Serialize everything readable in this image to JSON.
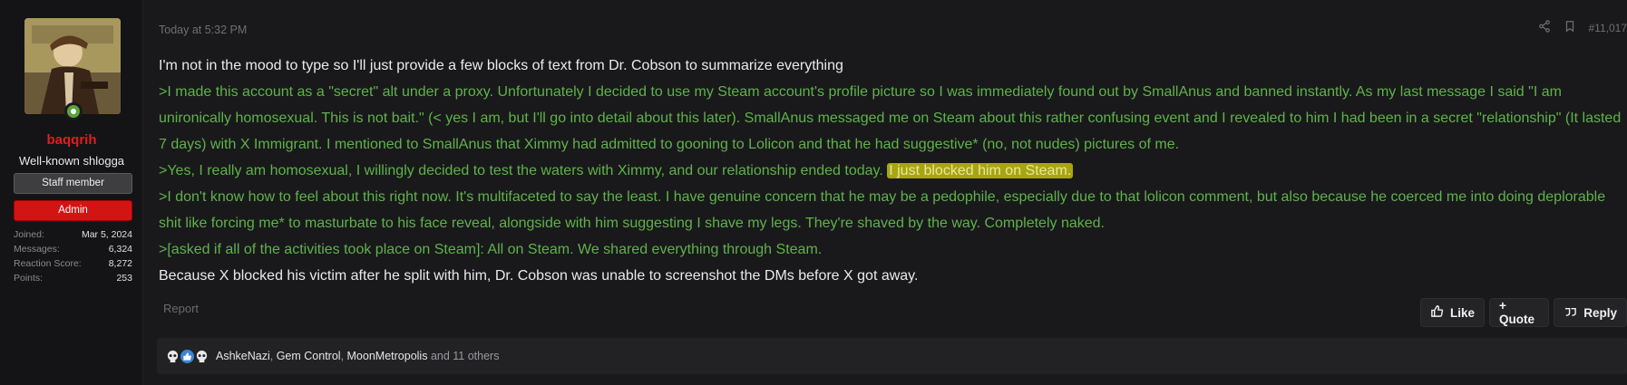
{
  "user": {
    "name": "baqqrih",
    "title": "Well-known shlogga",
    "banners": {
      "staff": "Staff member",
      "admin": "Admin"
    },
    "stats": [
      {
        "label": "Joined:",
        "value": "Mar 5, 2024"
      },
      {
        "label": "Messages:",
        "value": "6,324"
      },
      {
        "label": "Reaction Score:",
        "value": "8,272"
      },
      {
        "label": "Points:",
        "value": "253"
      }
    ],
    "online_color": "#5aa53a",
    "name_color": "#e21d1d"
  },
  "post": {
    "timestamp": "Today at 5:32 PM",
    "number": "#11,017",
    "lines": {
      "intro": "I'm not in the mood to type so I'll just provide a few blocks of text from Dr. Cobson to summarize everything",
      "q1": ">I made this account as a \"secret\" alt under a proxy. Unfortunately I decided to use my Steam account's profile picture so I was immediately found out by SmallAnus and banned instantly. As my last message I said \"I am unironically homosexual. This is not bait.\" (< yes I am, but I'll go into detail about this later). SmallAnus messaged me on Steam about this rather confusing event and I revealed to him I had been in a secret \"relationship\" (It lasted 7 days) with X Immigrant. I mentioned to SmallAnus that Ximmy had admitted to gooning to Lolicon and that he had suggestive* (no, not nudes) pictures of me.",
      "q2_pre": ">Yes, I really am homosexual, I willingly decided to test the waters with Ximmy, and our relationship ended today. ",
      "q2_hl": "I just blocked him on Steam.",
      "q3": ">I don't know how to feel about this right now. It's multifaceted to say the least. I have genuine concern that he may be a pedophile, especially due to that lolicon comment, but also because he coerced me into doing deplorable shit like forcing me* to masturbate to his face reveal, alongside with him suggesting I shave my legs. They're shaved by the way. Completely naked.",
      "q4": ">[asked if all of the activities took place on Steam]: All on Steam. We shared everything through Steam.",
      "outro": "Because X blocked his victim after he split with him, Dr. Cobson was unable to screenshot the DMs before X got away."
    },
    "quote_color": "#5fb24a",
    "highlight_color": "#a8a510"
  },
  "actions": {
    "report": "Report",
    "like": "Like",
    "quote": "+ Quote",
    "reply": "Reply"
  },
  "reactions": {
    "icons": [
      "skull-icon",
      "thumbs-up-icon",
      "skull-icon"
    ],
    "names": [
      "AshkeNazi",
      "Gem Control",
      "MoonMetropolis"
    ],
    "others": "and 11 others"
  }
}
